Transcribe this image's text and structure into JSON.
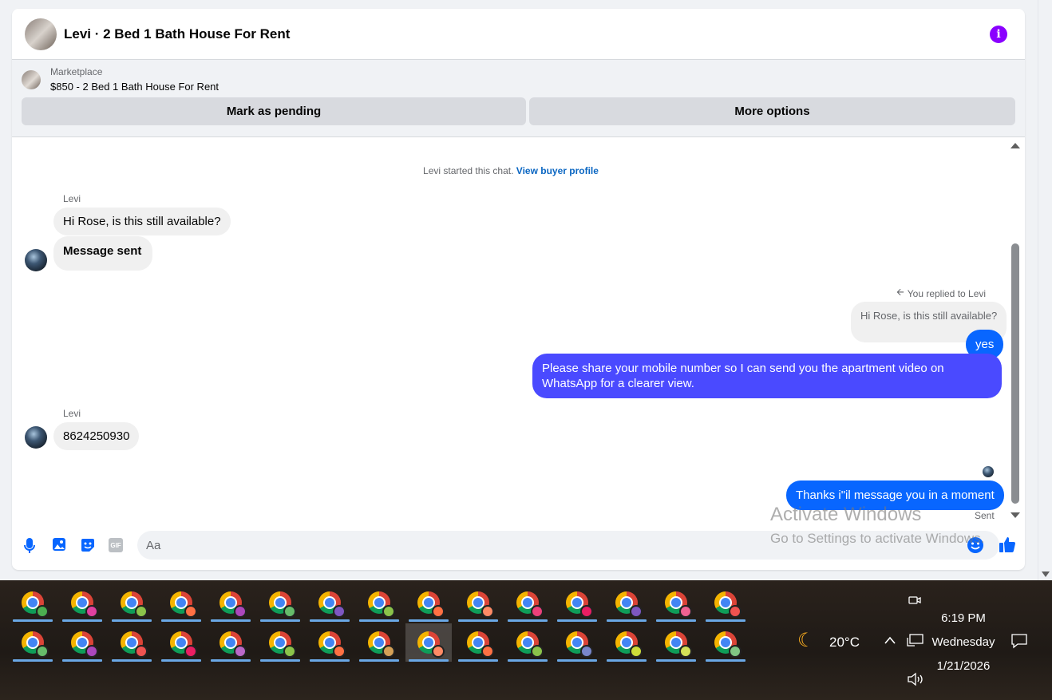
{
  "header": {
    "title": "Levi · 2 Bed 1 Bath House For Rent",
    "info_icon": "info-icon"
  },
  "listing": {
    "label": "Marketplace",
    "name": "$850 - 2 Bed 1 Bath House For Rent",
    "buttons": {
      "pending": "Mark as pending",
      "more": "More options"
    }
  },
  "messages": {
    "system_note_text": "Levi started this chat.",
    "system_note_link": "View buyer profile",
    "group1_sender": "Levi",
    "group1_msg1": "Hi Rose, is this still available?",
    "group1_msg2": "Message sent",
    "reply_label": "You replied to Levi",
    "reply_quote": "Hi Rose, is this still available?",
    "out_msg1": "yes",
    "out_msg2": "Please share your mobile number so I can send you the apartment video on WhatsApp for a clearer view.",
    "group2_sender": "Levi",
    "group2_msg1": "8624250930",
    "out_msg3": "Thanks i\"il message you in a moment",
    "sent_status": "Sent"
  },
  "composer": {
    "placeholder": "Aa",
    "gif_label": "GIF"
  },
  "watermark": {
    "title": "Activate Windows",
    "subtitle": "Go to Settings to activate Windows."
  },
  "taskbar": {
    "temperature": "20°C",
    "time": "6:19 PM",
    "day": "Wednesday",
    "date": "1/21/2026",
    "profile_colors_row1": [
      "#4caf50",
      "#e040a0",
      "#8bc34a",
      "#ff7043",
      "#ab47bc",
      "#66bb6a",
      "#7e57c2",
      "#8bc34a",
      "#ff7043",
      "#ff8a65",
      "#ec407a",
      "#e91e63",
      "#7e57c2",
      "#f06292",
      "#ef5350"
    ],
    "profile_colors_row2": [
      "#66bb6a",
      "#ab47bc",
      "#ef5350",
      "#e91e63",
      "#ba68c8",
      "#8bc34a",
      "#ff7043",
      "#d4a056",
      "#ff8a65",
      "#ff7043",
      "#8bc34a",
      "#7986cb",
      "#cddc39",
      "#d4e157",
      "#81c784"
    ]
  }
}
